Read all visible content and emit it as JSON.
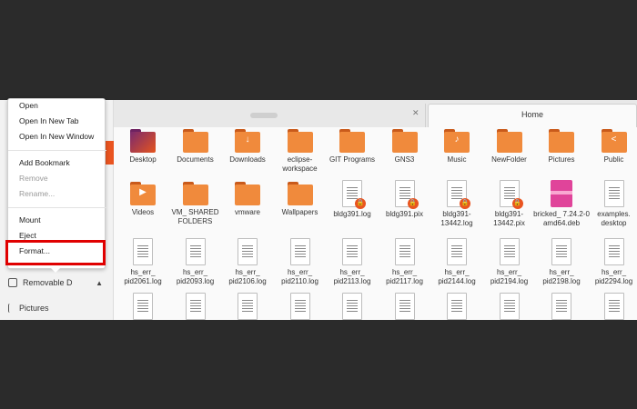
{
  "tabs": {
    "active_label": "Home"
  },
  "context_menu": {
    "items": [
      {
        "label": "Open",
        "disabled": false
      },
      {
        "label": "Open In New Tab",
        "disabled": false
      },
      {
        "label": "Open In New Window",
        "disabled": false
      },
      {
        "label": "Add Bookmark",
        "disabled": false
      },
      {
        "label": "Remove",
        "disabled": true
      },
      {
        "label": "Rename...",
        "disabled": true
      },
      {
        "label": "Mount",
        "disabled": false
      },
      {
        "label": "Eject",
        "disabled": false
      },
      {
        "label": "Format...",
        "disabled": false
      }
    ]
  },
  "sidebar": {
    "items": [
      {
        "label": "Removable D",
        "icon": "drive-icon"
      },
      {
        "label": "Pictures",
        "icon": "pictures-icon"
      }
    ]
  },
  "files": [
    {
      "name": "Desktop",
      "type": "folder-desktop"
    },
    {
      "name": "Documents",
      "type": "folder"
    },
    {
      "name": "Downloads",
      "type": "folder",
      "glyph": "↓"
    },
    {
      "name": "eclipse-workspace",
      "type": "folder"
    },
    {
      "name": "GIT Programs",
      "type": "folder"
    },
    {
      "name": "GNS3",
      "type": "folder"
    },
    {
      "name": "Music",
      "type": "folder",
      "glyph": "♪"
    },
    {
      "name": "NewFolder",
      "type": "folder"
    },
    {
      "name": "Pictures",
      "type": "folder"
    },
    {
      "name": "Public",
      "type": "folder",
      "glyph": "<"
    },
    {
      "name": "Videos",
      "type": "folder",
      "glyph": "▶"
    },
    {
      "name": "VM_ SHARED FOLDERS",
      "type": "folder"
    },
    {
      "name": "vmware",
      "type": "folder"
    },
    {
      "name": "Wallpapers",
      "type": "folder"
    },
    {
      "name": "bldg391.log",
      "type": "doc-locked"
    },
    {
      "name": "bldg391.pix",
      "type": "doc-locked"
    },
    {
      "name": "bldg391-13442.log",
      "type": "doc-locked"
    },
    {
      "name": "bldg391-13442.pix",
      "type": "doc-locked"
    },
    {
      "name": "bricked_ 7.24.2-0 amd64.deb",
      "type": "package"
    },
    {
      "name": "examples. desktop",
      "type": "doc"
    },
    {
      "name": "hs_err_ pid2061.log",
      "type": "doc"
    },
    {
      "name": "hs_err_ pid2093.log",
      "type": "doc"
    },
    {
      "name": "hs_err_ pid2106.log",
      "type": "doc"
    },
    {
      "name": "hs_err_ pid2110.log",
      "type": "doc"
    },
    {
      "name": "hs_err_ pid2113.log",
      "type": "doc"
    },
    {
      "name": "hs_err_ pid2117.log",
      "type": "doc"
    },
    {
      "name": "hs_err_ pid2144.log",
      "type": "doc"
    },
    {
      "name": "hs_err_ pid2194.log",
      "type": "doc"
    },
    {
      "name": "hs_err_ pid2198.log",
      "type": "doc"
    },
    {
      "name": "hs_err_ pid2294.log",
      "type": "doc"
    },
    {
      "name": "",
      "type": "doc"
    },
    {
      "name": "",
      "type": "doc"
    },
    {
      "name": "",
      "type": "doc"
    },
    {
      "name": "",
      "type": "doc"
    },
    {
      "name": "",
      "type": "doc"
    },
    {
      "name": "",
      "type": "doc"
    },
    {
      "name": "",
      "type": "doc"
    },
    {
      "name": "",
      "type": "doc"
    },
    {
      "name": "",
      "type": "doc"
    },
    {
      "name": "",
      "type": "doc"
    }
  ],
  "colors": {
    "accent": "#e95420",
    "folder": "#f08a3c",
    "highlight": "#e00000"
  }
}
